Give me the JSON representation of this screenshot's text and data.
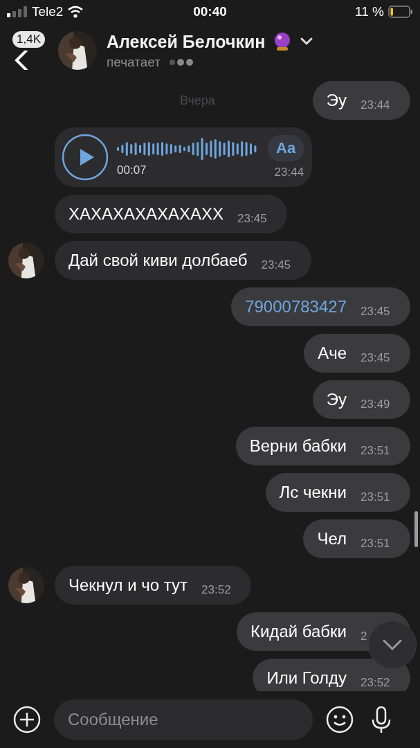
{
  "status_bar": {
    "carrier": "Tele2",
    "time": "00:40",
    "battery": "11 %"
  },
  "header": {
    "back_badge": "1,4K",
    "name": "Алексей Белочкин",
    "status": "печатает"
  },
  "date_label": "Вчера",
  "messages": [
    {
      "kind": "text",
      "text": "Эу",
      "time": "23:44",
      "outgoing": true,
      "avatar": false
    },
    {
      "kind": "voice",
      "duration": "00:07",
      "time": "23:44",
      "transcribe": "Aa",
      "outgoing": false,
      "avatar": false
    },
    {
      "kind": "text",
      "text": "ХАХАХАХАХАХАХХ",
      "time": "23:45",
      "outgoing": false,
      "avatar": false
    },
    {
      "kind": "text",
      "text": "Дай свой киви долбаеб",
      "time": "23:45",
      "outgoing": false,
      "avatar": true
    },
    {
      "kind": "link",
      "text": "79000783427",
      "time": "23:45",
      "outgoing": true,
      "avatar": false
    },
    {
      "kind": "text",
      "text": "Аче",
      "time": "23:45",
      "outgoing": true,
      "avatar": false
    },
    {
      "kind": "text",
      "text": "Эу",
      "time": "23:49",
      "outgoing": true,
      "avatar": false
    },
    {
      "kind": "text",
      "text": "Верни бабки",
      "time": "23:51",
      "outgoing": true,
      "avatar": false
    },
    {
      "kind": "text",
      "text": "Лс чекни",
      "time": "23:51",
      "outgoing": true,
      "avatar": false
    },
    {
      "kind": "text",
      "text": "Чел",
      "time": "23:51",
      "outgoing": true,
      "avatar": false
    },
    {
      "kind": "text",
      "text": "Чекнул и чо тут",
      "time": "23:52",
      "outgoing": false,
      "avatar": true
    },
    {
      "kind": "text",
      "text": "Кидай бабки",
      "time": "2",
      "outgoing": true,
      "avatar": false
    },
    {
      "kind": "text",
      "text": "Или Голду",
      "time": "23:52",
      "outgoing": true,
      "avatar": false
    }
  ],
  "composer": {
    "placeholder": "Сообщение"
  }
}
